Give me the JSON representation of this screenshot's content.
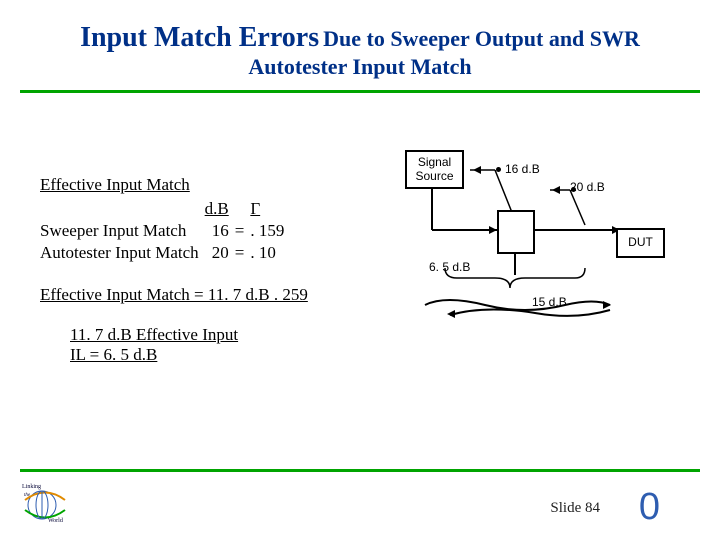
{
  "title": {
    "lead": "Input Match Errors",
    "tail": "Due to Sweeper Output and SWR",
    "subtitle": "Autotester Input Match"
  },
  "body": {
    "heading": "Effective Input Match",
    "col_db": "d.B",
    "col_gamma": "Γ",
    "rows": [
      {
        "label": "Sweeper Input Match",
        "db": "16",
        "eq": "=",
        "g": ". 159"
      },
      {
        "label": "Autotester Input Match",
        "db": "20",
        "eq": "=",
        "g": ". 10"
      }
    ],
    "equation": "Effective Input Match = 11. 7 d.B  . 259",
    "note1": "11. 7 d.B Effective Input",
    "note2": "IL = 6. 5 d.B"
  },
  "diagram": {
    "signal_box": "Signal\nSource",
    "dut_box": "DUT",
    "l16": "16 d.B",
    "l20": "20 d.B",
    "l65": "6. 5 d.B",
    "l15": "15 d.B"
  },
  "footer": {
    "slide_label": "Slide 84",
    "zero": "0"
  }
}
